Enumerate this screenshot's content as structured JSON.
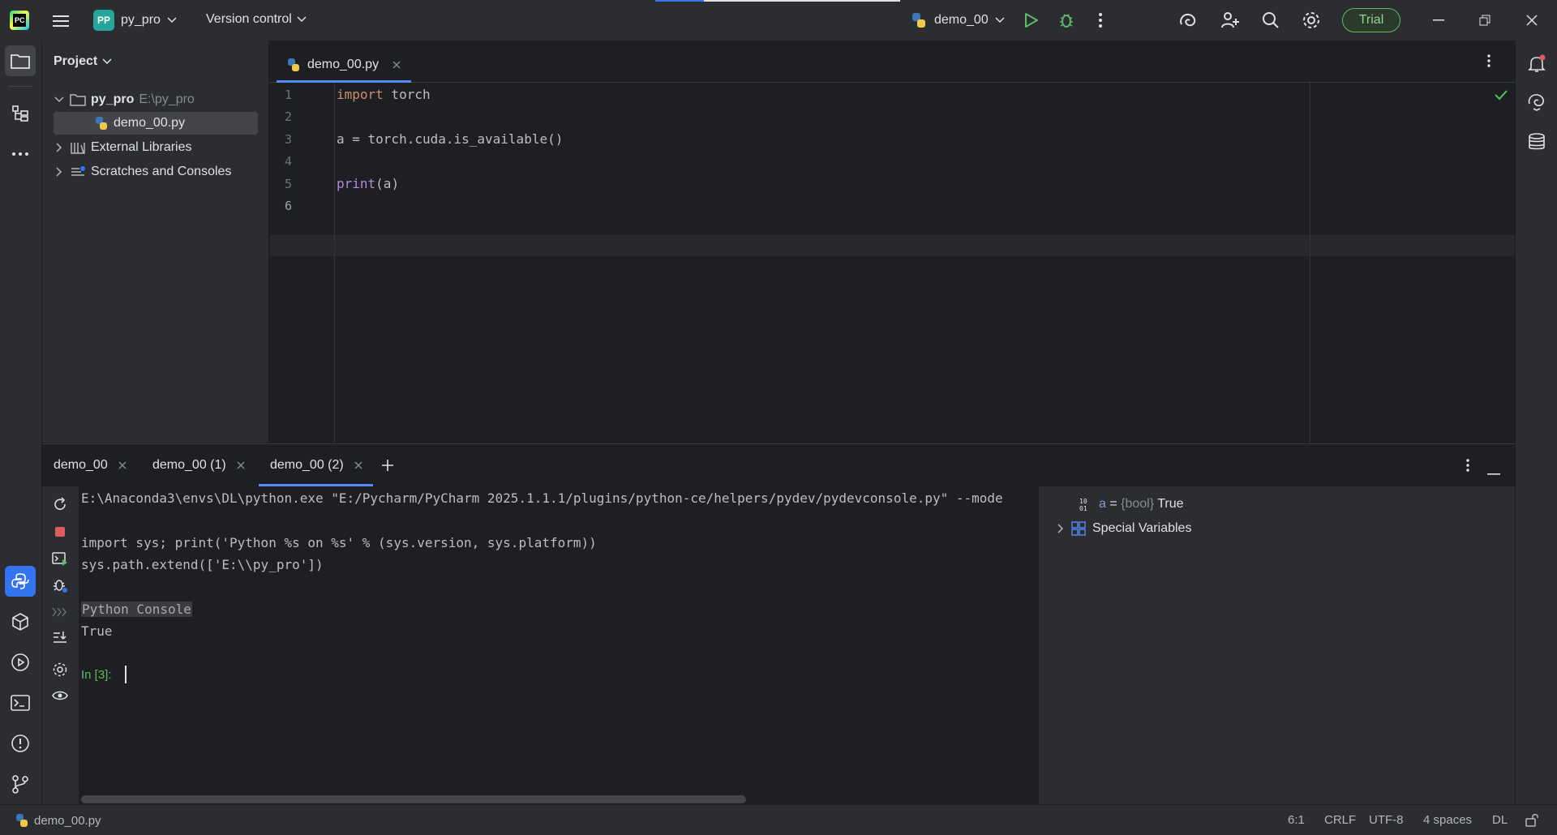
{
  "titlebar": {
    "project_badge": "PP",
    "project_name": "py_pro",
    "version_control": "Version control",
    "run_config": "demo_00",
    "trial": "Trial"
  },
  "project_pane": {
    "header": "Project",
    "root_name": "py_pro",
    "root_path": "E:\\py_pro",
    "file": "demo_00.py",
    "external_libraries": "External Libraries",
    "scratches": "Scratches and Consoles"
  },
  "editor": {
    "tab_label": "demo_00.py",
    "line_numbers": [
      "1",
      "2",
      "3",
      "4",
      "5",
      "6"
    ],
    "code": {
      "l1_kw": "import",
      "l1_rest": " torch",
      "l3": "a = torch.cuda.is_available()",
      "l5_fn": "print",
      "l5_rest": "(a)"
    }
  },
  "bottom": {
    "tabs": [
      "demo_00",
      "demo_00 (1)",
      "demo_00 (2)"
    ],
    "console_lines": {
      "cmd": "E:\\Anaconda3\\envs\\DL\\python.exe \"E:/Pycharm/PyCharm 2025.1.1.1/plugins/python-ce/helpers/pydev/pydevconsole.py\" --mode",
      "import_sys": "import sys; print('Python %s on %s' % (sys.version, sys.platform))",
      "path_extend": "sys.path.extend(['E:\\\\py_pro'])",
      "console_title": "Python Console",
      "result": "True",
      "prompt": "In [3]:"
    },
    "variables": {
      "var_name": "a",
      "var_eq": " = ",
      "var_type": "{bool}",
      "var_value": "True",
      "special": "Special Variables"
    }
  },
  "statusbar": {
    "file": "demo_00.py",
    "position": "6:1",
    "line_ending": "CRLF",
    "encoding": "UTF-8",
    "indent": "4 spaces",
    "interpreter": "DL"
  },
  "colors": {
    "accent": "#3574f0",
    "background": "#1e1f22",
    "panel": "#2b2d30",
    "keyword": "#cf8e6d",
    "function": "#b28ada",
    "success": "#5fb865"
  }
}
